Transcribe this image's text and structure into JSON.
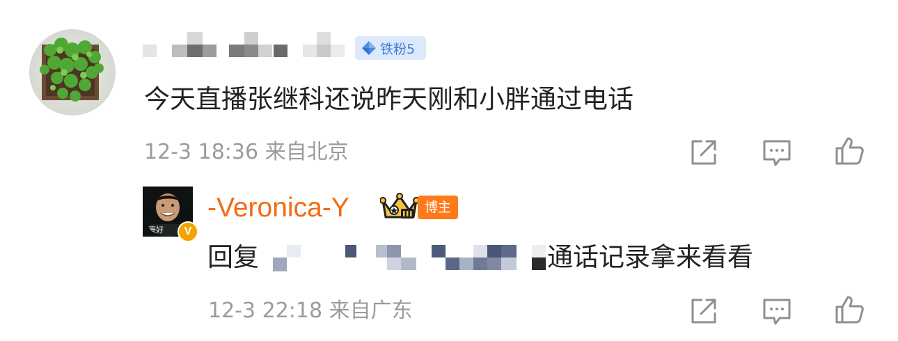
{
  "comment": {
    "badge_label": "铁粉5",
    "text": "今天直播张继科还说昨天刚和小胖通过电话",
    "timestamp": "12-3 18:36",
    "location": "来自北京"
  },
  "reply": {
    "username": "-Veronica-Y",
    "badge_label": "博主",
    "avatar_caption": "豪好",
    "verified_mark": "V",
    "prefix": "回复",
    "text": "通话记录拿来看看",
    "timestamp": "12-3 22:18",
    "location": "来自广东"
  },
  "colors": {
    "username_accent": "#f26b12",
    "fan_badge_text": "#3f7fd6",
    "fan_badge_bg": "#dde9fb",
    "blogger_badge_bg": "#ff7a1a",
    "meta_text": "#9b9b9b",
    "body_text": "#222222",
    "icon_gray": "#8f8f8f"
  },
  "icons": {
    "share": "share-icon",
    "comment": "comment-icon",
    "like": "like-icon",
    "fan_diamond": "diamond-icon",
    "crown": "crown-icon"
  }
}
